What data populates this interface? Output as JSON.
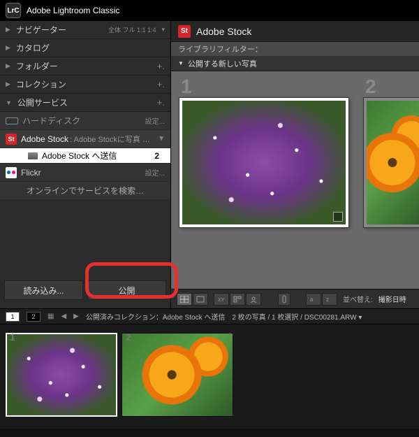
{
  "app": {
    "name": "Adobe Lightroom Classic",
    "logo": "LrC"
  },
  "left_panel": {
    "navigator": {
      "label": "ナビゲーター",
      "opts": "全体  フル  1:1  1:4"
    },
    "catalog": {
      "label": "カタログ"
    },
    "folders": {
      "label": "フォルダー"
    },
    "collections": {
      "label": "コレクション"
    },
    "publish_services": {
      "label": "公開サービス",
      "hdd": {
        "label": "ハードディスク",
        "action": "設定..."
      },
      "adobe": {
        "label": "Adobe Stock",
        "sub": ": Adobe Stockに写真 …",
        "badge": "St"
      },
      "child": {
        "label": "Adobe Stock へ送信",
        "count": "2"
      },
      "flickr": {
        "label": "Flickr",
        "action": "設定..."
      },
      "search": {
        "label": "オンラインでサービスを検索…"
      }
    }
  },
  "left_footer": {
    "import": "読み込み...",
    "publish": "公開"
  },
  "content": {
    "header": {
      "badge": "St",
      "title": "Adobe Stock"
    },
    "filter_label": "ライブラリフィルター：",
    "section_label": "公開する新しい写真",
    "grid_numbers": [
      "1",
      "2"
    ]
  },
  "toolbar": {
    "sort_label": "並べ替え:",
    "sort_value": "撮影日時"
  },
  "filmstrip": {
    "pages": [
      "1",
      "2"
    ],
    "status": "公開済みコレクション：Adobe Stock へ送信　2 枚の写真 / 1 枚選択 / DSC00281.ARW ▾",
    "cells": [
      "1",
      "2"
    ]
  }
}
